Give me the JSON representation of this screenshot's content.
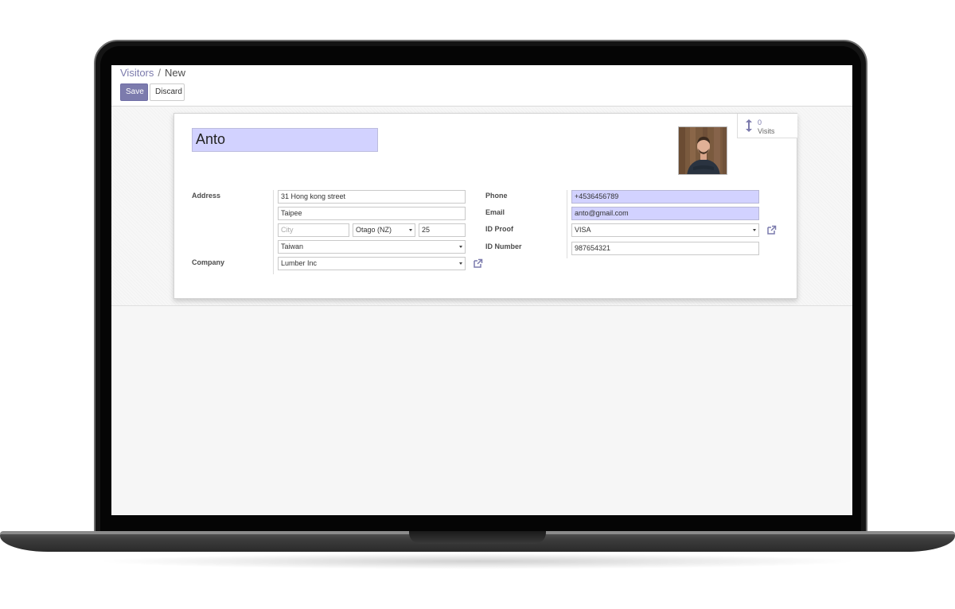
{
  "breadcrumb": {
    "parent": "Visitors",
    "separator": "/",
    "current": "New"
  },
  "toolbar": {
    "save_label": "Save",
    "discard_label": "Discard"
  },
  "visits": {
    "count": "0",
    "label": "Visits"
  },
  "visitor": {
    "name": "Anto"
  },
  "labels": {
    "address": "Address",
    "company": "Company",
    "phone": "Phone",
    "email": "Email",
    "id_proof": "ID Proof",
    "id_number": "ID Number"
  },
  "address": {
    "street": "31 Hong kong street",
    "street2": "Taipee",
    "city_placeholder": "City",
    "state": "Otago (NZ)",
    "zip": "25",
    "country": "Taiwan"
  },
  "company": "Lumber Inc",
  "phone": "+4536456789",
  "email": "anto@gmail.com",
  "id_proof": "VISA",
  "id_number": "987654321",
  "colors": {
    "accent": "#7c7bad",
    "required_bg": "#d2d2ff"
  }
}
